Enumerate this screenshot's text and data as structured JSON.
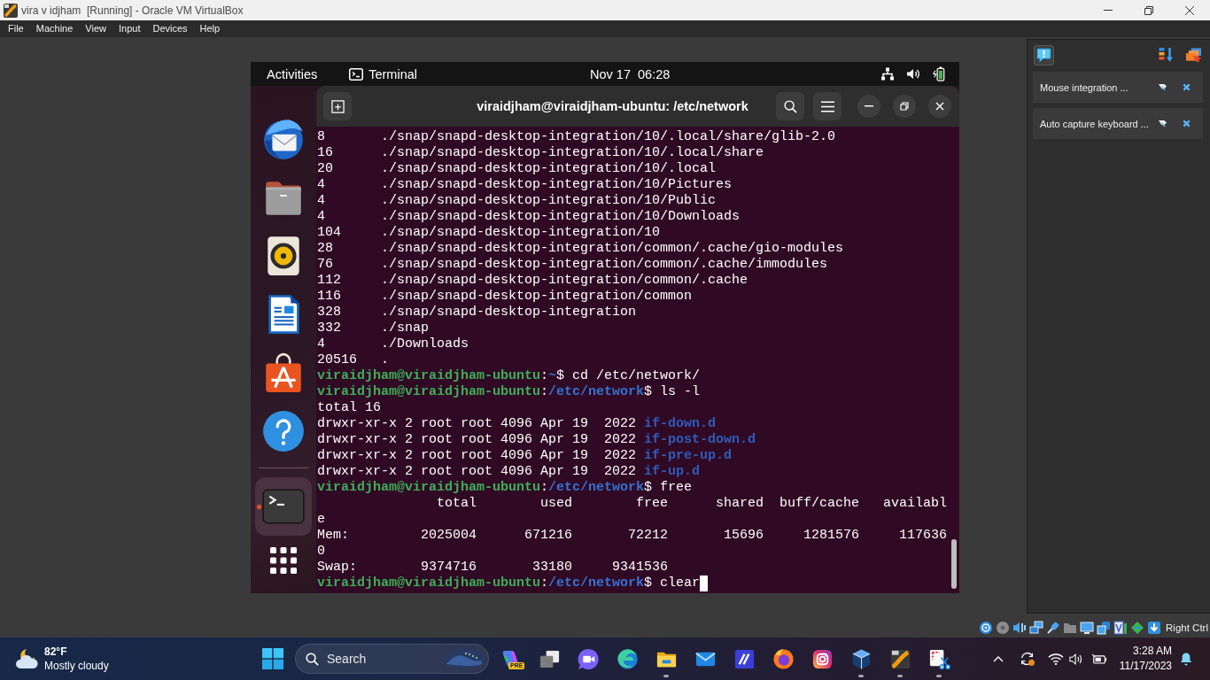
{
  "window": {
    "title": "vira v idjham  [Running] - Oracle VM VirtualBox"
  },
  "menu": [
    "File",
    "Machine",
    "View",
    "Input",
    "Devices",
    "Help"
  ],
  "vm": {
    "top_bar": {
      "activities": "Activities",
      "app": "Terminal",
      "clock": "Nov 17  06:28"
    },
    "dock": {
      "pinned": [
        {
          "kind": "mail",
          "running": false,
          "focused": false
        },
        {
          "kind": "files",
          "running": false,
          "focused": false
        },
        {
          "kind": "music",
          "running": false,
          "focused": false
        },
        {
          "kind": "writer",
          "running": false,
          "focused": false
        },
        {
          "kind": "store",
          "running": false,
          "focused": false
        },
        {
          "kind": "help",
          "running": false,
          "focused": false
        }
      ],
      "unpinned": [
        {
          "kind": "terminal",
          "running": true,
          "focused": true
        }
      ]
    },
    "terminal": {
      "title": "viraidjham@viraidjham-ubuntu: /etc/network",
      "cursor": true,
      "lines": [
        [
          {
            "kind": "plain",
            "text": "8       ./snap/snapd-desktop-integration/10/.local/share/glib-2.0"
          }
        ],
        [
          {
            "kind": "plain",
            "text": "16      ./snap/snapd-desktop-integration/10/.local/share"
          }
        ],
        [
          {
            "kind": "plain",
            "text": "20      ./snap/snapd-desktop-integration/10/.local"
          }
        ],
        [
          {
            "kind": "plain",
            "text": "4       ./snap/snapd-desktop-integration/10/Pictures"
          }
        ],
        [
          {
            "kind": "plain",
            "text": "4       ./snap/snapd-desktop-integration/10/Public"
          }
        ],
        [
          {
            "kind": "plain",
            "text": "4       ./snap/snapd-desktop-integration/10/Downloads"
          }
        ],
        [
          {
            "kind": "plain",
            "text": "104     ./snap/snapd-desktop-integration/10"
          }
        ],
        [
          {
            "kind": "plain",
            "text": "28      ./snap/snapd-desktop-integration/common/.cache/gio-modules"
          }
        ],
        [
          {
            "kind": "plain",
            "text": "76      ./snap/snapd-desktop-integration/common/.cache/immodules"
          }
        ],
        [
          {
            "kind": "plain",
            "text": "112     ./snap/snapd-desktop-integration/common/.cache"
          }
        ],
        [
          {
            "kind": "plain",
            "text": "116     ./snap/snapd-desktop-integration/common"
          }
        ],
        [
          {
            "kind": "plain",
            "text": "328     ./snap/snapd-desktop-integration"
          }
        ],
        [
          {
            "kind": "plain",
            "text": "332     ./snap"
          }
        ],
        [
          {
            "kind": "plain",
            "text": "4       ./Downloads"
          }
        ],
        [
          {
            "kind": "plain",
            "text": "20516   ."
          }
        ],
        [
          {
            "kind": "user",
            "text": "viraidjham@viraidjham-ubuntu"
          },
          {
            "kind": "plain",
            "text": ":"
          },
          {
            "kind": "path",
            "text": "~"
          },
          {
            "kind": "plain",
            "text": "$ cd /etc/network/"
          }
        ],
        [
          {
            "kind": "user",
            "text": "viraidjham@viraidjham-ubuntu"
          },
          {
            "kind": "plain",
            "text": ":"
          },
          {
            "kind": "path",
            "text": "/etc/network"
          },
          {
            "kind": "plain",
            "text": "$ ls -l"
          }
        ],
        [
          {
            "kind": "plain",
            "text": "total 16"
          }
        ],
        [
          {
            "kind": "plain",
            "text": "drwxr-xr-x 2 root root 4096 Apr 19  2022 "
          },
          {
            "kind": "dir",
            "text": "if-down.d"
          }
        ],
        [
          {
            "kind": "plain",
            "text": "drwxr-xr-x 2 root root 4096 Apr 19  2022 "
          },
          {
            "kind": "dir",
            "text": "if-post-down.d"
          }
        ],
        [
          {
            "kind": "plain",
            "text": "drwxr-xr-x 2 root root 4096 Apr 19  2022 "
          },
          {
            "kind": "dir",
            "text": "if-pre-up.d"
          }
        ],
        [
          {
            "kind": "plain",
            "text": "drwxr-xr-x 2 root root 4096 Apr 19  2022 "
          },
          {
            "kind": "dir",
            "text": "if-up.d"
          }
        ],
        [
          {
            "kind": "user",
            "text": "viraidjham@viraidjham-ubuntu"
          },
          {
            "kind": "plain",
            "text": ":"
          },
          {
            "kind": "path",
            "text": "/etc/network"
          },
          {
            "kind": "plain",
            "text": "$ free"
          }
        ],
        [
          {
            "kind": "plain",
            "text": "               total        used        free      shared  buff/cache   availabl"
          }
        ],
        [
          {
            "kind": "plain",
            "text": "e"
          }
        ],
        [
          {
            "kind": "plain",
            "text": "Mem:         2025004      671216       72212       15696     1281576     117636"
          }
        ],
        [
          {
            "kind": "plain",
            "text": "0"
          }
        ],
        [
          {
            "kind": "plain",
            "text": "Swap:        9374716       33180     9341536"
          }
        ],
        [
          {
            "kind": "user",
            "text": "viraidjham@viraidjham-ubuntu"
          },
          {
            "kind": "plain",
            "text": ":"
          },
          {
            "kind": "path",
            "text": "/etc/network"
          },
          {
            "kind": "plain",
            "text": "$ clear"
          }
        ]
      ]
    }
  },
  "notifications": [
    {
      "text": "Mouse integration ..."
    },
    {
      "text": "Auto capture keyboard ..."
    }
  ],
  "status_bar": {
    "host_key": "Right Ctrl"
  },
  "taskbar": {
    "weather": {
      "temperature": "82°F",
      "condition": "Mostly cloudy"
    },
    "search": {
      "placeholder": "Search"
    },
    "apps": [
      {
        "kind": "copilot",
        "running": false,
        "badge": "PRE"
      },
      {
        "kind": "taskview",
        "running": false
      },
      {
        "kind": "chat",
        "running": false
      },
      {
        "kind": "edge",
        "running": false
      },
      {
        "kind": "explorer",
        "running": true
      },
      {
        "kind": "mail",
        "running": false
      },
      {
        "kind": "slash",
        "running": false
      },
      {
        "kind": "firefox",
        "running": false
      },
      {
        "kind": "instagram",
        "running": false
      },
      {
        "kind": "cube",
        "running": true
      },
      {
        "kind": "vm",
        "running": true
      },
      {
        "kind": "snip",
        "running": true
      }
    ],
    "clock": {
      "time": "3:28 AM",
      "date": "11/17/2023"
    }
  }
}
